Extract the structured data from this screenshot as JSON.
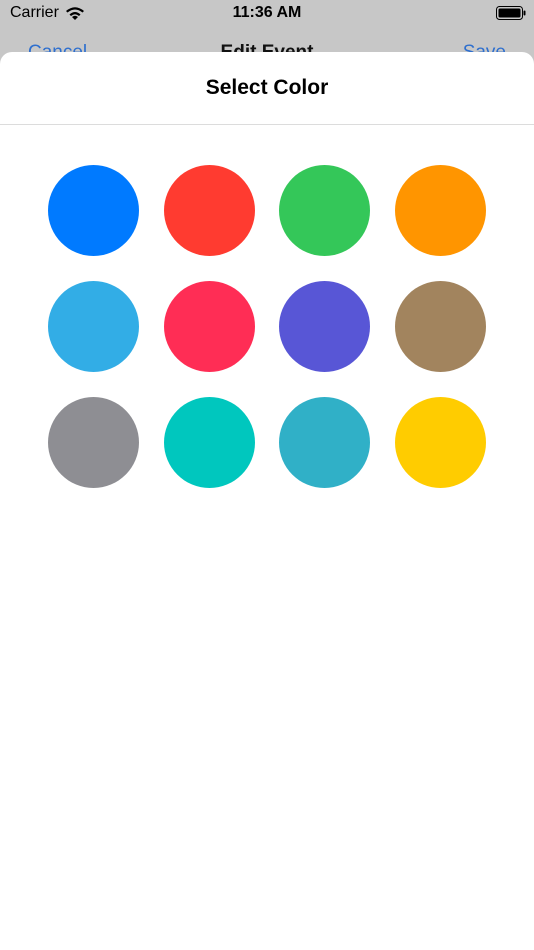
{
  "status_bar": {
    "carrier": "Carrier",
    "time": "11:36 AM"
  },
  "nav_behind": {
    "left": "Cancel",
    "title": "Edit Event",
    "right": "Save"
  },
  "sheet": {
    "title": "Select Color"
  },
  "swatches": [
    {
      "color": "#007aff"
    },
    {
      "color": "#ff3b30"
    },
    {
      "color": "#34c759"
    },
    {
      "color": "#ff9500"
    },
    {
      "color": "#32ade6"
    },
    {
      "color": "#ff2d55"
    },
    {
      "color": "#5856d6"
    },
    {
      "color": "#a2845e"
    },
    {
      "color": "#8e8e93"
    },
    {
      "color": "#00c7be"
    },
    {
      "color": "#30b0c7"
    },
    {
      "color": "#ffcc00"
    }
  ]
}
